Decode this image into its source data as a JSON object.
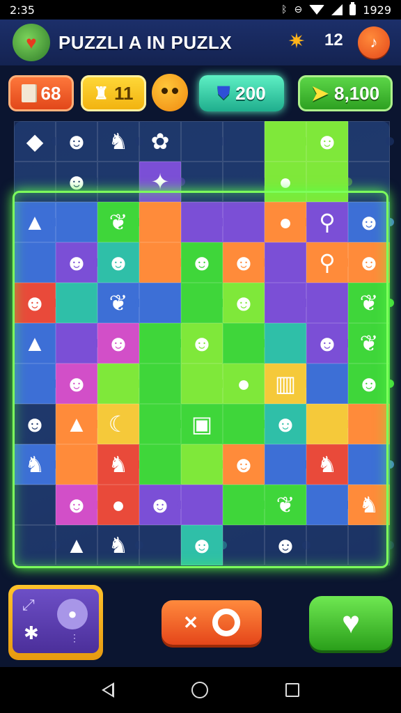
{
  "status": {
    "time": "2:35",
    "clock_right": "1929"
  },
  "header": {
    "title": "PUZZLI A IN PUZLX",
    "level": "12",
    "logo_glyph": "♥"
  },
  "counters": {
    "pages": "68",
    "pieces": "11",
    "gems": "200",
    "stars": "8,100"
  },
  "board": {
    "tiles": [
      "t-dark",
      "t-dark",
      "t-dark",
      "t-dark",
      "t-dark",
      "t-dark",
      "t-lime",
      "t-lime",
      "t-dark",
      "t-dark",
      "t-dark",
      "t-dark",
      "t-purple",
      "t-dark",
      "t-dark",
      "t-lime",
      "t-lime",
      "t-dark",
      "t-blue",
      "t-blue",
      "t-green",
      "t-orange",
      "t-purple",
      "t-purple",
      "t-orange",
      "t-purple",
      "t-blue",
      "t-blue",
      "t-purple",
      "t-teal",
      "t-orange",
      "t-green",
      "t-orange",
      "t-purple",
      "t-orange",
      "t-orange",
      "t-red",
      "t-teal",
      "t-blue",
      "t-blue",
      "t-green",
      "t-lime",
      "t-purple",
      "t-purple",
      "t-green",
      "t-blue",
      "t-purple",
      "t-pink",
      "t-green",
      "t-lime",
      "t-green",
      "t-teal",
      "t-purple",
      "t-green",
      "t-blue",
      "t-pink",
      "t-lime",
      "t-green",
      "t-lime",
      "t-lime",
      "t-yellow",
      "t-blue",
      "t-green",
      "t-dark",
      "t-orange",
      "t-yellow",
      "t-green",
      "t-green",
      "t-green",
      "t-teal",
      "t-yellow",
      "t-orange",
      "t-blue",
      "t-orange",
      "t-red",
      "t-green",
      "t-lime",
      "t-orange",
      "t-blue",
      "t-red",
      "t-blue",
      "t-dark",
      "t-pink",
      "t-red",
      "t-purple",
      "t-purple",
      "t-green",
      "t-green",
      "t-blue",
      "t-orange",
      "t-dark",
      "t-dark",
      "t-dark",
      "t-dark",
      "t-teal",
      "t-dark",
      "t-dark",
      "t-dark",
      "t-dark"
    ],
    "glyphs": [
      "◆",
      "☻",
      "♞",
      "✿",
      "",
      "",
      "",
      "☻",
      "",
      "",
      "☻",
      "",
      "✦",
      "",
      "",
      "●",
      "",
      "",
      "▲",
      "",
      "❦",
      "",
      "",
      "",
      "●",
      "⚲",
      "☻",
      "",
      "☻",
      "☻",
      "",
      "☻",
      "☻",
      "",
      "⚲",
      "☻",
      "☻",
      "",
      "❦",
      "",
      "",
      "☻",
      "",
      "",
      "❦",
      "▲",
      "",
      "☻",
      "",
      "☻",
      "",
      "",
      "☻",
      "❦",
      "",
      "☻",
      "",
      "",
      "",
      "●",
      "▥",
      "",
      "☻",
      "☻",
      "▲",
      "☾",
      "",
      "▣",
      "",
      "☻",
      "",
      "",
      "♞",
      "",
      "♞",
      "",
      "",
      "☻",
      "",
      "♞",
      "",
      "",
      "☻",
      "●",
      "☻",
      "",
      "",
      "❦",
      "",
      "♞",
      "",
      "▲",
      "♞",
      "",
      "☻",
      "",
      "☻",
      "",
      ""
    ]
  },
  "buttons": {
    "mid_label": "✕",
    "heart": "♥"
  },
  "colors": {
    "glow": "#7dff5c",
    "accent_orange": "#e5461a",
    "accent_green": "#2a9f1a"
  }
}
